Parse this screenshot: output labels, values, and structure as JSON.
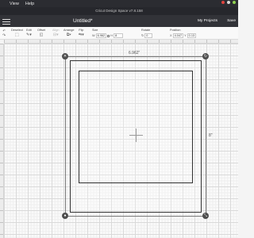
{
  "menubar": {
    "items": [
      "",
      "View",
      "Help"
    ]
  },
  "window": {
    "title": "Cricut Design Space  v7.8.158"
  },
  "header": {
    "doc_title": "Untitled*",
    "my_projects": "My Projects",
    "save": "Save"
  },
  "toolbar": {
    "undo": "Undo",
    "redo": "Redo",
    "linetype_label": "Linetype",
    "linetype_value": "Cut",
    "deselect": "Deselect",
    "edit": "Edit",
    "offset": "Offset",
    "align": "Align",
    "arrange": "Arrange",
    "flip": "Flip",
    "size": "Size",
    "w_label": "W",
    "w_value": "6.962",
    "h_label": "H",
    "h_value": "8",
    "rotate": "Rotate",
    "rotate_value": "0",
    "position": "Position",
    "x_label": "X",
    "x_value": "4.047",
    "y_label": "Y",
    "y_value": "0.13"
  },
  "canvas": {
    "width_dimension": "6.962\"",
    "height_dimension": "8\""
  },
  "icons": [
    "menu-icon",
    "undo-icon",
    "redo-icon",
    "lock-icon",
    "delete-icon",
    "rotate-icon",
    "resize-icon"
  ]
}
